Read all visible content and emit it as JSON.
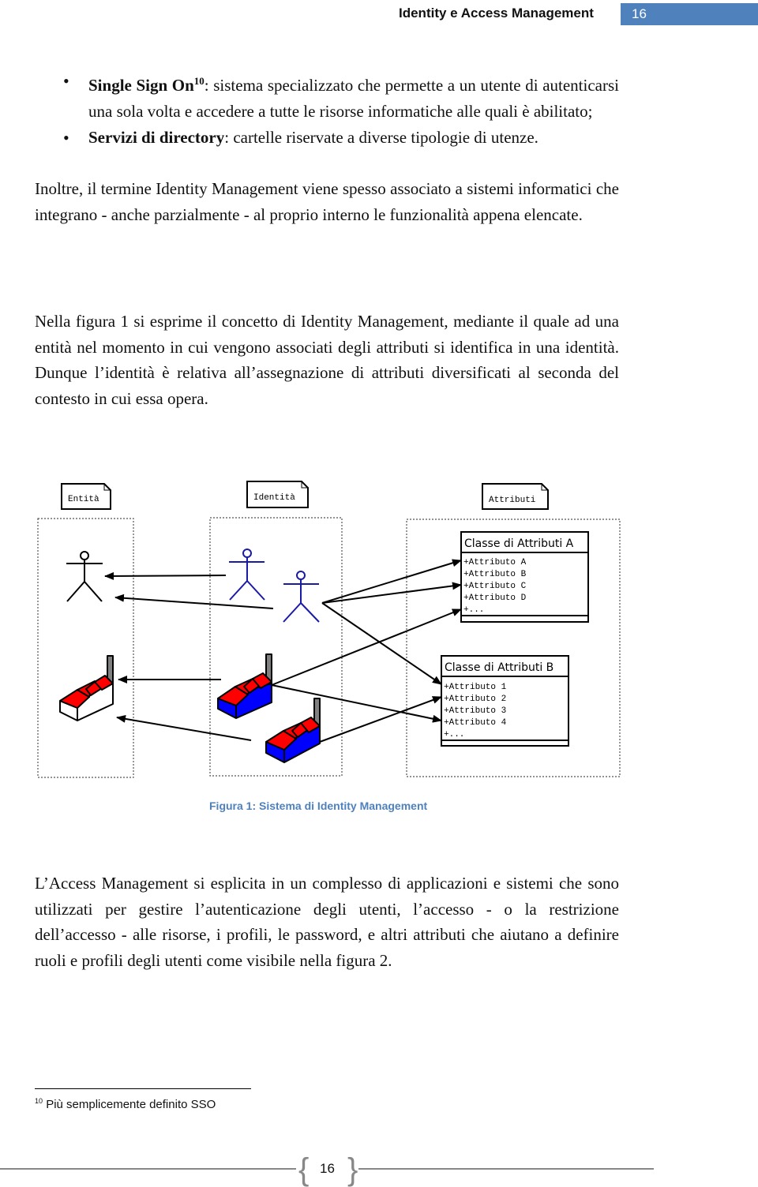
{
  "header": {
    "title": "Identity e Access Management",
    "page_number": "16",
    "accent_color": "#4f81bd"
  },
  "bullets": [
    {
      "term": "Single Sign On",
      "footnote_ref": "10",
      "text": ": sistema specializzato che permette a un utente di autenticarsi una sola volta e accedere a tutte le risorse informatiche alle quali è abilitato;"
    },
    {
      "term": "Servizi di directory",
      "footnote_ref": "",
      "text": ": cartelle riservate a diverse tipologie di utenze."
    }
  ],
  "paragraphs": {
    "p1": "Inoltre, il termine Identity Management viene spesso associato a sistemi informatici che integrano - anche parzialmente - al proprio interno le funzionalità appena elencate.",
    "p2": "Nella figura 1 si esprime il concetto di Identity Management, mediante il quale ad una entità nel momento in cui vengono associati degli attributi si identifica in una identità. Dunque l’identità è relativa all’assegnazione di attributi diversificati al seconda del contesto in cui essa opera.",
    "p3": "L’Access Management si esplicita in un complesso di applicazioni e sistemi che sono utilizzati per gestire l’autenticazione degli utenti, l’accesso - o la restrizione dell’accesso - alle risorse, i profili, le password, e altri attributi che aiutano a definire ruoli e profili degli utenti come visibile nella figura 2."
  },
  "figure": {
    "notes": {
      "entita": "Entità",
      "identita": "Identità",
      "attributi": "Attributi"
    },
    "class_a": {
      "title": "Classe di Attributi A",
      "items": [
        "+Attributo A",
        "+Attributo B",
        "+Attributo C",
        "+Attributo D",
        "+..."
      ]
    },
    "class_b": {
      "title": "Classe di Attributi B",
      "items": [
        "+Attributo 1",
        "+Attributo 2",
        "+Attributo 3",
        "+Attributo 4",
        "+..."
      ]
    },
    "caption": "Figura 1: Sistema di Identity Management",
    "colors": {
      "identity_person": "#1a1aa8",
      "roof": "#ff0000",
      "factory_identity": "#0000ff",
      "chimney": "#808080"
    }
  },
  "footnote": {
    "number": "10",
    "text": "Più semplicemente definito SSO"
  },
  "footer": {
    "page_number": "16"
  }
}
